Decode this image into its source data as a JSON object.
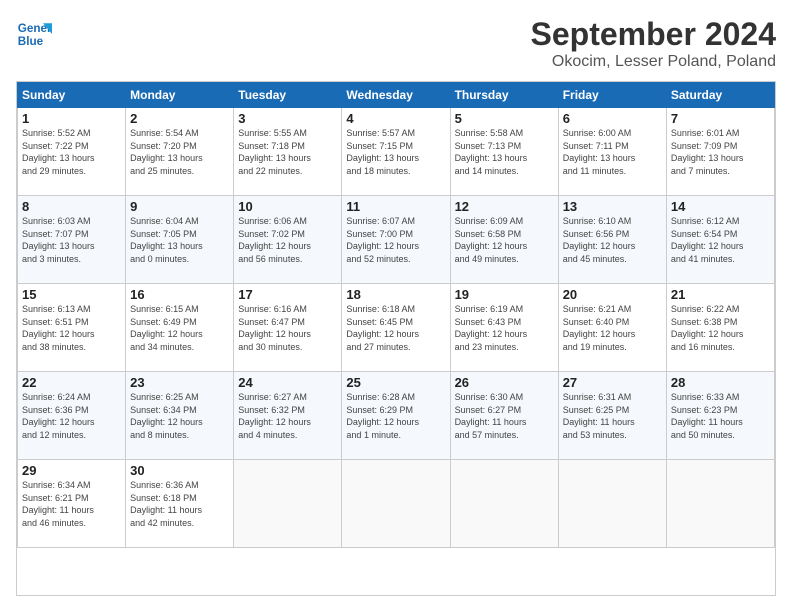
{
  "logo": {
    "line1": "General",
    "line2": "Blue"
  },
  "title": "September 2024",
  "subtitle": "Okocim, Lesser Poland, Poland",
  "weekdays": [
    "Sunday",
    "Monday",
    "Tuesday",
    "Wednesday",
    "Thursday",
    "Friday",
    "Saturday"
  ],
  "weeks": [
    [
      {
        "day": "1",
        "info": "Sunrise: 5:52 AM\nSunset: 7:22 PM\nDaylight: 13 hours\nand 29 minutes."
      },
      {
        "day": "2",
        "info": "Sunrise: 5:54 AM\nSunset: 7:20 PM\nDaylight: 13 hours\nand 25 minutes."
      },
      {
        "day": "3",
        "info": "Sunrise: 5:55 AM\nSunset: 7:18 PM\nDaylight: 13 hours\nand 22 minutes."
      },
      {
        "day": "4",
        "info": "Sunrise: 5:57 AM\nSunset: 7:15 PM\nDaylight: 13 hours\nand 18 minutes."
      },
      {
        "day": "5",
        "info": "Sunrise: 5:58 AM\nSunset: 7:13 PM\nDaylight: 13 hours\nand 14 minutes."
      },
      {
        "day": "6",
        "info": "Sunrise: 6:00 AM\nSunset: 7:11 PM\nDaylight: 13 hours\nand 11 minutes."
      },
      {
        "day": "7",
        "info": "Sunrise: 6:01 AM\nSunset: 7:09 PM\nDaylight: 13 hours\nand 7 minutes."
      }
    ],
    [
      {
        "day": "8",
        "info": "Sunrise: 6:03 AM\nSunset: 7:07 PM\nDaylight: 13 hours\nand 3 minutes."
      },
      {
        "day": "9",
        "info": "Sunrise: 6:04 AM\nSunset: 7:05 PM\nDaylight: 13 hours\nand 0 minutes."
      },
      {
        "day": "10",
        "info": "Sunrise: 6:06 AM\nSunset: 7:02 PM\nDaylight: 12 hours\nand 56 minutes."
      },
      {
        "day": "11",
        "info": "Sunrise: 6:07 AM\nSunset: 7:00 PM\nDaylight: 12 hours\nand 52 minutes."
      },
      {
        "day": "12",
        "info": "Sunrise: 6:09 AM\nSunset: 6:58 PM\nDaylight: 12 hours\nand 49 minutes."
      },
      {
        "day": "13",
        "info": "Sunrise: 6:10 AM\nSunset: 6:56 PM\nDaylight: 12 hours\nand 45 minutes."
      },
      {
        "day": "14",
        "info": "Sunrise: 6:12 AM\nSunset: 6:54 PM\nDaylight: 12 hours\nand 41 minutes."
      }
    ],
    [
      {
        "day": "15",
        "info": "Sunrise: 6:13 AM\nSunset: 6:51 PM\nDaylight: 12 hours\nand 38 minutes."
      },
      {
        "day": "16",
        "info": "Sunrise: 6:15 AM\nSunset: 6:49 PM\nDaylight: 12 hours\nand 34 minutes."
      },
      {
        "day": "17",
        "info": "Sunrise: 6:16 AM\nSunset: 6:47 PM\nDaylight: 12 hours\nand 30 minutes."
      },
      {
        "day": "18",
        "info": "Sunrise: 6:18 AM\nSunset: 6:45 PM\nDaylight: 12 hours\nand 27 minutes."
      },
      {
        "day": "19",
        "info": "Sunrise: 6:19 AM\nSunset: 6:43 PM\nDaylight: 12 hours\nand 23 minutes."
      },
      {
        "day": "20",
        "info": "Sunrise: 6:21 AM\nSunset: 6:40 PM\nDaylight: 12 hours\nand 19 minutes."
      },
      {
        "day": "21",
        "info": "Sunrise: 6:22 AM\nSunset: 6:38 PM\nDaylight: 12 hours\nand 16 minutes."
      }
    ],
    [
      {
        "day": "22",
        "info": "Sunrise: 6:24 AM\nSunset: 6:36 PM\nDaylight: 12 hours\nand 12 minutes."
      },
      {
        "day": "23",
        "info": "Sunrise: 6:25 AM\nSunset: 6:34 PM\nDaylight: 12 hours\nand 8 minutes."
      },
      {
        "day": "24",
        "info": "Sunrise: 6:27 AM\nSunset: 6:32 PM\nDaylight: 12 hours\nand 4 minutes."
      },
      {
        "day": "25",
        "info": "Sunrise: 6:28 AM\nSunset: 6:29 PM\nDaylight: 12 hours\nand 1 minute."
      },
      {
        "day": "26",
        "info": "Sunrise: 6:30 AM\nSunset: 6:27 PM\nDaylight: 11 hours\nand 57 minutes."
      },
      {
        "day": "27",
        "info": "Sunrise: 6:31 AM\nSunset: 6:25 PM\nDaylight: 11 hours\nand 53 minutes."
      },
      {
        "day": "28",
        "info": "Sunrise: 6:33 AM\nSunset: 6:23 PM\nDaylight: 11 hours\nand 50 minutes."
      }
    ],
    [
      {
        "day": "29",
        "info": "Sunrise: 6:34 AM\nSunset: 6:21 PM\nDaylight: 11 hours\nand 46 minutes."
      },
      {
        "day": "30",
        "info": "Sunrise: 6:36 AM\nSunset: 6:18 PM\nDaylight: 11 hours\nand 42 minutes."
      },
      {
        "day": "",
        "info": ""
      },
      {
        "day": "",
        "info": ""
      },
      {
        "day": "",
        "info": ""
      },
      {
        "day": "",
        "info": ""
      },
      {
        "day": "",
        "info": ""
      }
    ]
  ]
}
